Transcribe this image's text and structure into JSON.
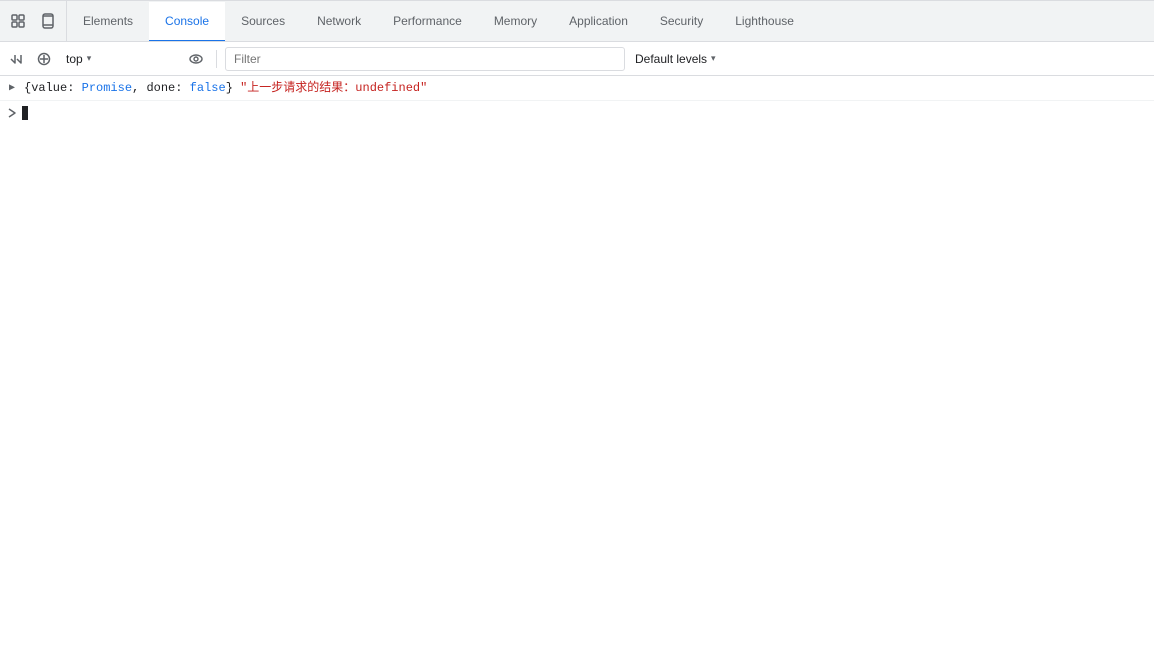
{
  "tabs": [
    {
      "id": "elements",
      "label": "Elements",
      "active": false
    },
    {
      "id": "console",
      "label": "Console",
      "active": true
    },
    {
      "id": "sources",
      "label": "Sources",
      "active": false
    },
    {
      "id": "network",
      "label": "Network",
      "active": false
    },
    {
      "id": "performance",
      "label": "Performance",
      "active": false
    },
    {
      "id": "memory",
      "label": "Memory",
      "active": false
    },
    {
      "id": "application",
      "label": "Application",
      "active": false
    },
    {
      "id": "security",
      "label": "Security",
      "active": false
    },
    {
      "id": "lighthouse",
      "label": "Lighthouse",
      "active": false
    }
  ],
  "toolbar": {
    "inspect_label": "Inspect",
    "device_label": "Device",
    "context_value": "top",
    "filter_placeholder": "Filter",
    "levels_label": "Default levels"
  },
  "console": {
    "entry": {
      "prefix": "▶",
      "object_start": "{",
      "key1": "value",
      "colon1": ":",
      "val1": " Promise",
      "comma1": ",",
      "key2": " done",
      "colon2": ":",
      "val2": " false",
      "object_end": "}",
      "string_part": "\"上一步请求的结果：undefined\""
    },
    "input_prompt": ">"
  },
  "icons": {
    "inspect": "⬚",
    "device": "⧉",
    "clear": "🚫",
    "eye": "◉",
    "chevron": "▾"
  }
}
